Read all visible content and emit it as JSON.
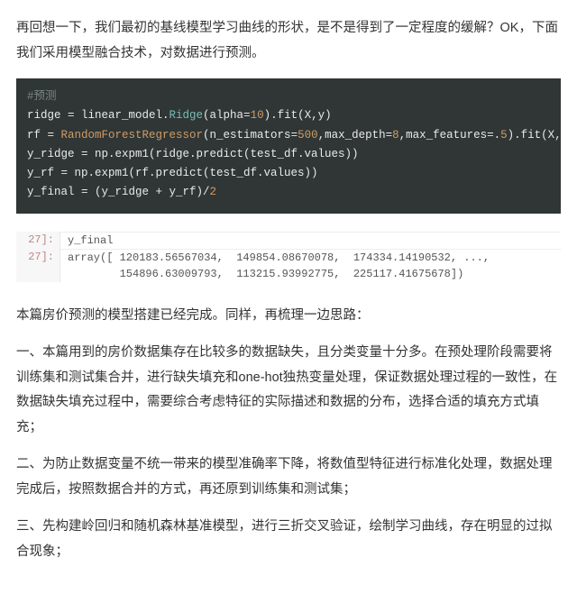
{
  "intro": "再回想一下，我们最初的基线模型学习曲线的形状，是不是得到了一定程度的缓解？OK，下面我们采用模型融合技术，对数据进行预测。",
  "code": {
    "comment": "#预测",
    "l1_a": "ridge = linear_model.",
    "l1_b": "Ridge",
    "l1_c": "(alpha=",
    "l1_d": "10",
    "l1_e": ").fit(X,y)",
    "l2_a": "rf = ",
    "l2_b": "RandomForestRegressor",
    "l2_c": "(n_estimators=",
    "l2_d": "500",
    "l2_e": ",max_depth=",
    "l2_f": "8",
    "l2_g": ",max_features=.",
    "l2_h": "5",
    "l2_i": ").fit(X,y)",
    "l3": "y_ridge = np.expm1(ridge.predict(test_df.values))",
    "l4": "y_rf = np.expm1(rf.predict(test_df.values))",
    "l5_a": "y_final = (y_ridge + y_rf)/",
    "l5_b": "2"
  },
  "output": {
    "g1": "27]:",
    "r1": "y_final",
    "g2": "27]:",
    "r2": "array([ 120183.56567034,  149854.08670078,  174334.14190532, ...,\n        154896.63009793,  113215.93992775,  225117.41675678])"
  },
  "after_output": "本篇房价预测的模型搭建已经完成。同样，再梳理一边思路：",
  "sec1": "一、本篇用到的房价数据集存在比较多的数据缺失，且分类变量十分多。在预处理阶段需要将训练集和测试集合并，进行缺失填充和one-hot独热变量处理，保证数据处理过程的一致性，在数据缺失填充过程中，需要综合考虑特征的实际描述和数据的分布，选择合适的填充方式填充；",
  "sec2": "二、为防止数据变量不统一带来的模型准确率下降，将数值型特征进行标准化处理，数据处理完成后，按照数据合并的方式，再还原到训练集和测试集；",
  "sec3": "三、先构建岭回归和随机森林基准模型，进行三折交叉验证，绘制学习曲线，存在明显的过拟合现象；"
}
